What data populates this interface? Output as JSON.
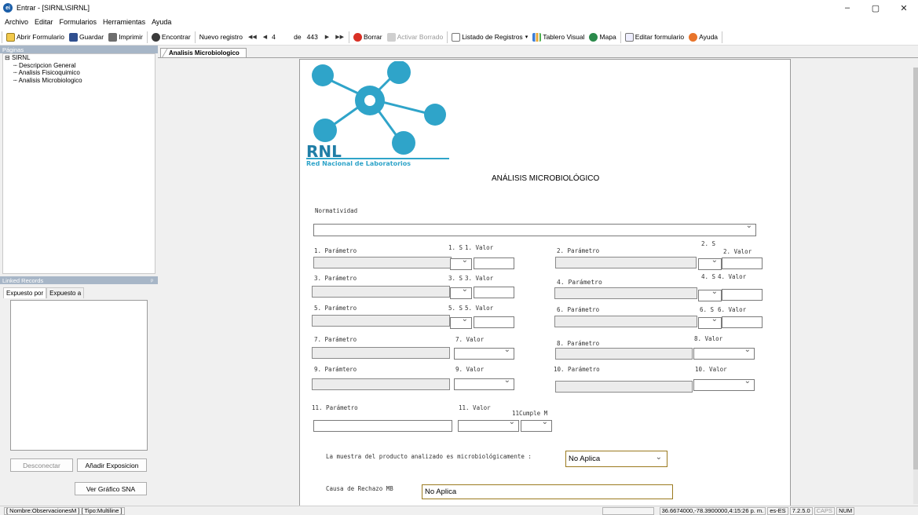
{
  "window": {
    "title": "Entrar - [SIRNL\\SIRNL]",
    "app_icon": "ei",
    "minimize": "–",
    "maximize": "▢",
    "close": "✕"
  },
  "menu": [
    "Archivo",
    "Editar",
    "Formularios",
    "Herramientas",
    "Ayuda"
  ],
  "toolbar": {
    "open": "Abrir Formulario",
    "save": "Guardar",
    "print": "Imprimir",
    "find": "Encontrar",
    "new_record": "Nuevo registro",
    "first": "◀◀",
    "prev": "◀",
    "record_num": "4",
    "of_label": "de",
    "total": "443",
    "next": "▶",
    "last": "▶▶",
    "delete": "Borrar",
    "undelete": "Activar Borrado",
    "list": "Listado de Registros",
    "dashboard": "Tablero Visual",
    "map": "Mapa",
    "edit_form": "Editar formulario",
    "help": "Ayuda"
  },
  "pages_panel": {
    "title": "Páginas",
    "root": "SIRNL",
    "items": [
      "Descripcion General",
      "Analisis Fisicoquimico",
      "Analisis Microbiologico"
    ]
  },
  "linked_panel": {
    "title": "Linked Records",
    "pin": "ᵖ",
    "tabs": [
      "Expuesto por",
      "Expuesto a"
    ],
    "disconnect": "Desconectar",
    "add": "Añadir Exposicion",
    "graph": "Ver Gráfico SNA"
  },
  "doc_tab": "Analisis Microbiologico",
  "form": {
    "logo_text": "RNL",
    "logo_sub": "Red Nacional de Laboratorios",
    "heading": "ANÁLISIS MICROBIOLÓGICO",
    "normatividad": "Normatividad",
    "rows": [
      {
        "p_l": "1. Parámetro",
        "s_l": "1. S",
        "v_l": "1. Valor",
        "p_r": "2. Parámetro",
        "s_r": "2. S",
        "v_r": "2. Valor"
      },
      {
        "p_l": "3. Parámetro",
        "s_l": "3. S",
        "v_l": "3. Valor",
        "p_r": "4. Parámetro",
        "s_r": "4. S",
        "v_r": "4. Valor"
      },
      {
        "p_l": "5. Parámetro",
        "s_l": "5. S",
        "v_l": "5. Valor",
        "p_r": "6. Parámetro",
        "s_r": "6. S",
        "v_r": "6. Valor"
      }
    ],
    "p7": "7. Parámetro",
    "v7": "7. Valor",
    "p8": "8. Parámetro",
    "v8": "8. Valor",
    "p9": "9. Parámtero",
    "v9": "9. Valor",
    "p10": "10. Parámetro",
    "v10": "10. Valor",
    "p11": "11. Parámetro",
    "v11": "11. Valor",
    "c11": "11Cumple M",
    "muestra_label": "La muestra del producto analizado es microbiológicamente :",
    "muestra_value": "No Aplica",
    "causa_label": "Causa de Rechazo MB",
    "causa_value": "No Aplica"
  },
  "status": {
    "field": "[ Nombre:ObservacionesM ] [ Tipo:Multiline ]",
    "coords": "36.6674000,-78.3900000,4:15:26 p. m.",
    "locale": "es-ES",
    "version": "7.2.5.0",
    "caps": "CAPS",
    "num": "NUM"
  }
}
